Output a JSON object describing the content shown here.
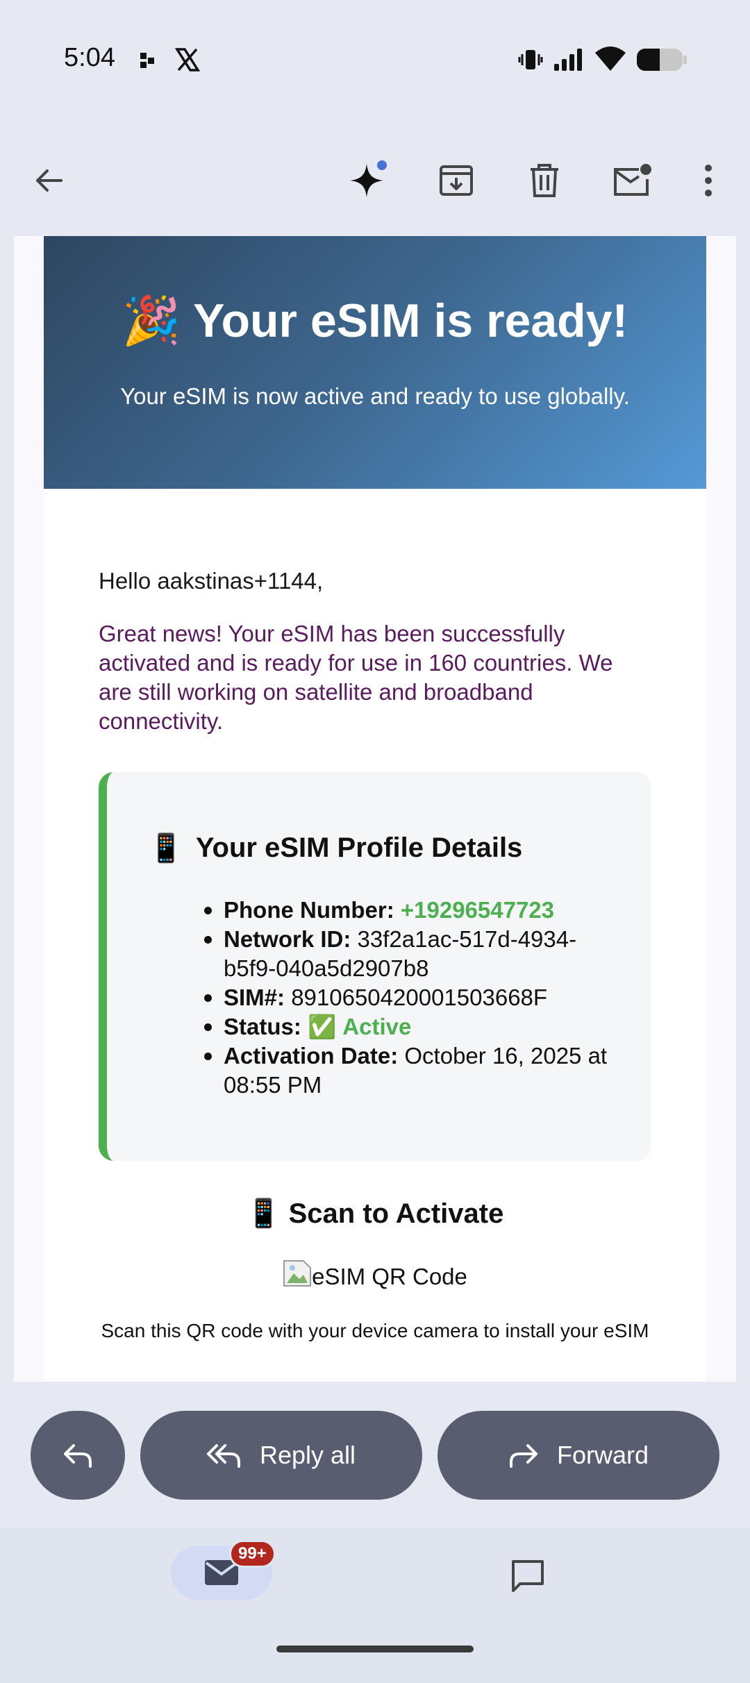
{
  "status_bar": {
    "time": "5:04",
    "icons": [
      "app-notification-icon",
      "x-logo-icon",
      "vibrate-icon",
      "signal-icon",
      "wifi-icon",
      "battery-icon"
    ]
  },
  "toolbar": {
    "icons": [
      "back-arrow-icon",
      "gemini-sparkle-icon",
      "archive-icon",
      "delete-icon",
      "mark-unread-icon",
      "more-options-icon"
    ]
  },
  "email": {
    "banner": {
      "emoji": "🎉",
      "title": "Your eSIM is ready!",
      "subtitle": "Your eSIM is now active and ready to use globally."
    },
    "greeting": "Hello aakstinas+1144,",
    "news": "Great news! Your eSIM has been successfully activated and is ready for use in 160 countries. We are still working on satellite and broadband connectivity.",
    "card": {
      "emoji": "📱",
      "title": "Your eSIM Profile Details",
      "phone_label": "Phone Number:",
      "phone_value": "+19296547723",
      "network_label": "Network ID:",
      "network_value": "33f2a1ac-517d-4934-b5f9-040a5d2907b8",
      "sim_label": "SIM#:",
      "sim_value": "8910650420001503668F",
      "status_label": "Status:",
      "status_emoji": "✅",
      "status_value": "Active",
      "activation_label": "Activation Date:",
      "activation_value": "October 16, 2025 at 08:55 PM"
    },
    "scan": {
      "emoji": "📱",
      "title": "Scan to Activate",
      "qr_alt": "eSIM QR Code",
      "description": "Scan this QR code with your device camera to install your eSIM"
    }
  },
  "reply_bar": {
    "reply_all_label": "Reply all",
    "forward_label": "Forward"
  },
  "bottom_nav": {
    "mail_badge": "99+"
  },
  "colors": {
    "banner_start": "#2e4660",
    "banner_end": "#5499d6",
    "accent_green": "#4caf50",
    "news_text": "#5a1a5e",
    "button_bg": "#585e70",
    "badge_bg": "#b3261e"
  }
}
